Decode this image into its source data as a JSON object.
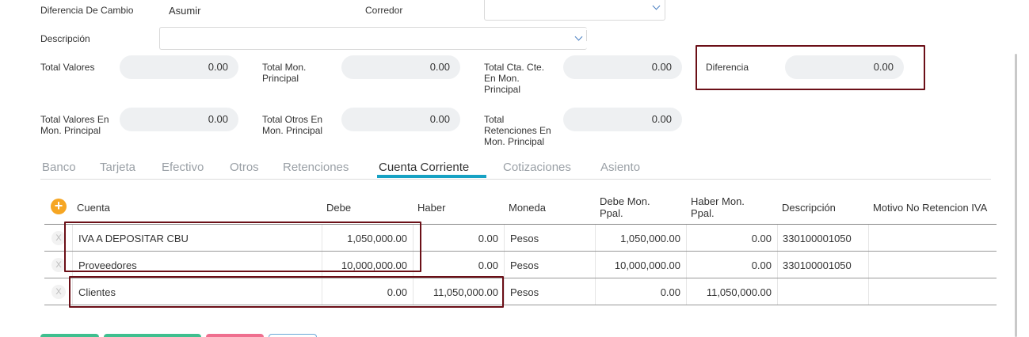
{
  "header": {
    "diferencia_cambio": {
      "label": "Diferencia De Cambio",
      "value": "Asumir"
    },
    "corredor": {
      "label": "Corredor",
      "value": ""
    },
    "descripcion": {
      "label": "Descripción",
      "value": ""
    }
  },
  "totals": {
    "total_valores": {
      "label_lines": [
        "Total Valores"
      ],
      "value": "0.00"
    },
    "total_mon_principal": {
      "label_lines": [
        "Total Mon.",
        "Principal"
      ],
      "value": "0.00"
    },
    "total_cta_cte": {
      "label_lines": [
        "Total Cta. Cte.",
        "En Mon.",
        "Principal"
      ],
      "value": "0.00"
    },
    "diferencia": {
      "label_lines": [
        "Diferencia"
      ],
      "value": "0.00"
    },
    "total_valores_mon": {
      "label_lines": [
        "Total Valores En",
        "Mon. Principal"
      ],
      "value": "0.00"
    },
    "total_otros": {
      "label_lines": [
        "Total Otros En",
        "Mon. Principal"
      ],
      "value": "0.00"
    },
    "total_retenciones": {
      "label_lines": [
        "Total",
        "Retenciones En",
        "Mon. Principal"
      ],
      "value": "0.00"
    }
  },
  "tabs": [
    "Banco",
    "Tarjeta",
    "Efectivo",
    "Otros",
    "Retenciones",
    "Cuenta Corriente",
    "Cotizaciones",
    "Asiento"
  ],
  "active_tab": "Cuenta Corriente",
  "table": {
    "add_icon": "plus-circle-icon",
    "remove_icon": "x-icon",
    "remove_glyph": "X",
    "columns": [
      {
        "lines": [
          "Cuenta"
        ]
      },
      {
        "lines": [
          "Debe"
        ]
      },
      {
        "lines": [
          "Haber"
        ]
      },
      {
        "lines": [
          "Moneda"
        ]
      },
      {
        "lines": [
          "Debe Mon.",
          "Ppal."
        ]
      },
      {
        "lines": [
          "Haber Mon.",
          "Ppal."
        ]
      },
      {
        "lines": [
          "Descripción"
        ]
      },
      {
        "lines": [
          "Motivo No Retencion IVA"
        ]
      }
    ],
    "rows": [
      {
        "cuenta": "IVA A DEPOSITAR CBU",
        "debe": "1,050,000.00",
        "haber": "0.00",
        "moneda": "Pesos",
        "debe_ppal": "1,050,000.00",
        "haber_ppal": "0.00",
        "descripcion": "330100001050",
        "motivo": ""
      },
      {
        "cuenta": "Proveedores",
        "debe": "10,000,000.00",
        "haber": "0.00",
        "moneda": "Pesos",
        "debe_ppal": "10,000,000.00",
        "haber_ppal": "0.00",
        "descripcion": "330100001050",
        "motivo": ""
      },
      {
        "cuenta": "Clientes",
        "debe": "0.00",
        "haber": "11,050,000.00",
        "moneda": "Pesos",
        "debe_ppal": "0.00",
        "haber_ppal": "11,050,000.00",
        "descripcion": "",
        "motivo": ""
      }
    ]
  },
  "colors": {
    "highlight": "#6b0f17",
    "tab_accent": "#17a2c4",
    "add_button": "#f6a623",
    "footer_green": "#3fbf8f",
    "footer_pink": "#ef6f8f",
    "footer_blue": "#6aa8d8"
  }
}
